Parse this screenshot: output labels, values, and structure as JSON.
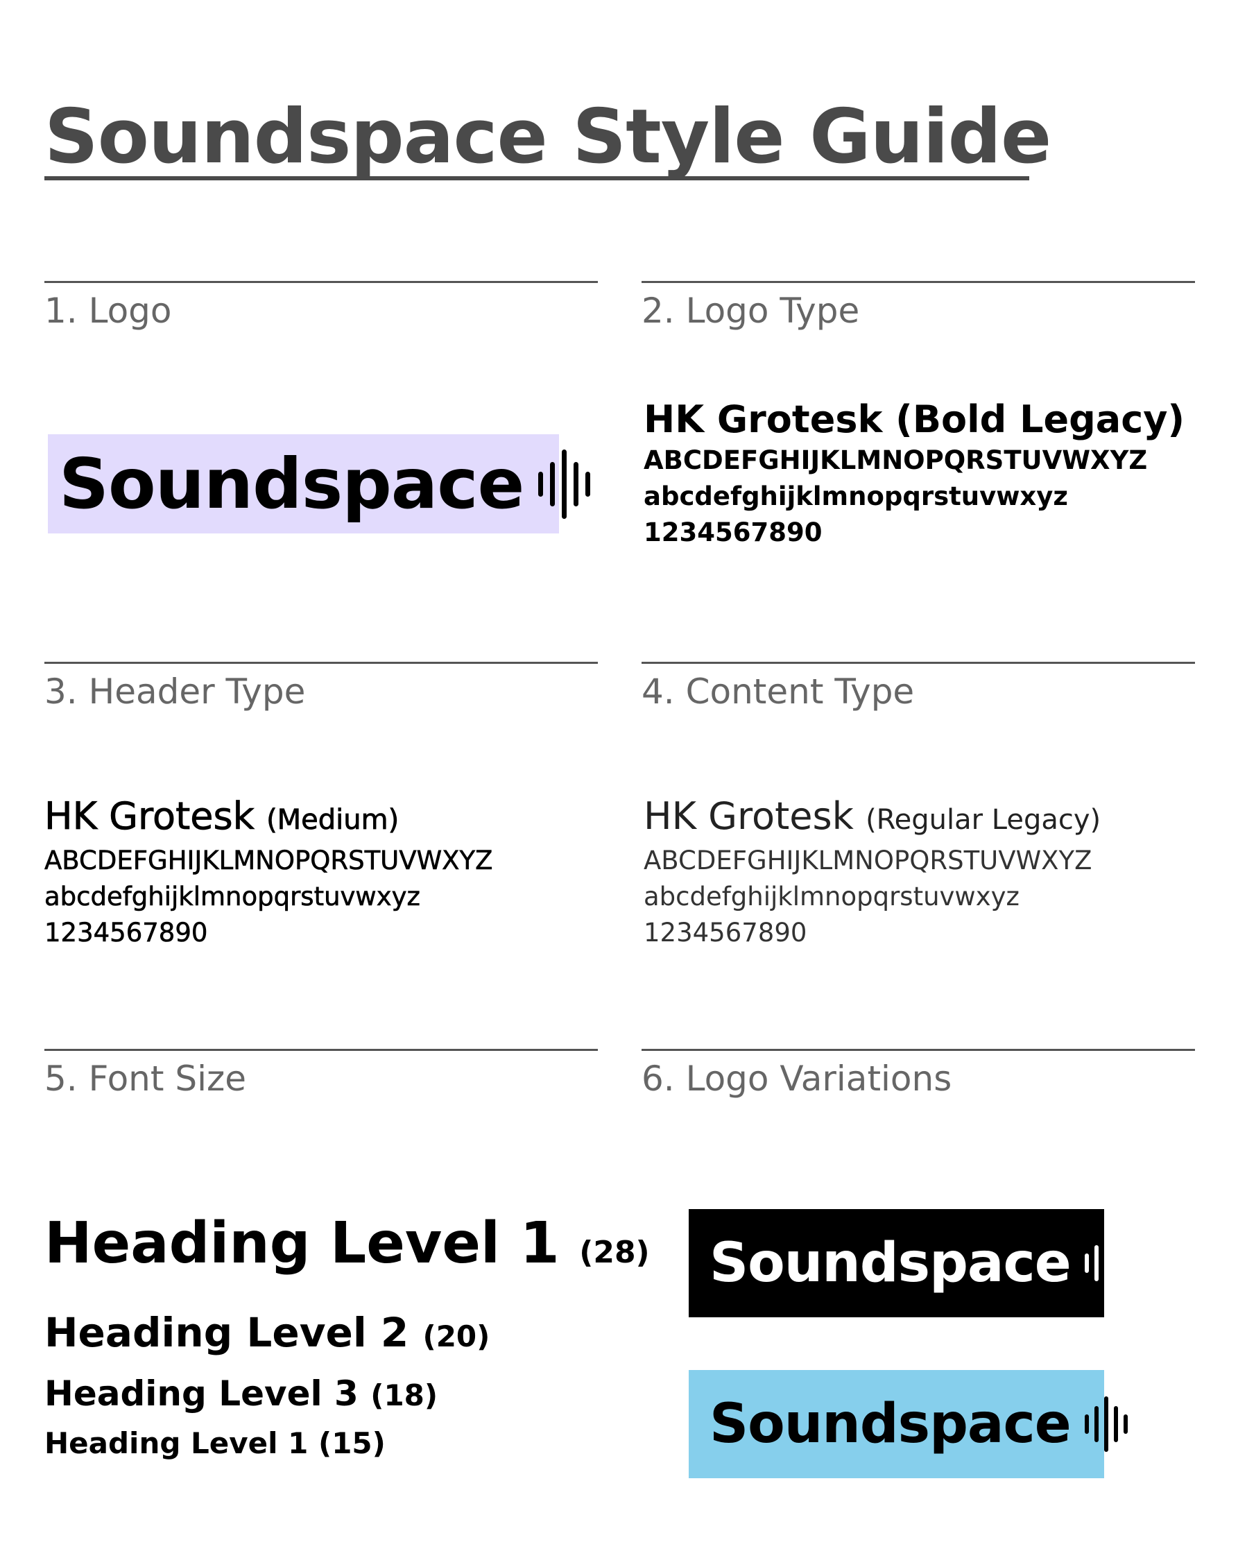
{
  "title": "Soundspace Style Guide",
  "sections": {
    "logo": {
      "label": "1. Logo"
    },
    "logo_type": {
      "label": "2. Logo Type"
    },
    "header_type": {
      "label": "3. Header Type"
    },
    "content_type": {
      "label": "4. Content Type"
    },
    "font_size": {
      "label": "5. Font Size"
    },
    "logo_variations": {
      "label": "6. Logo Variations"
    }
  },
  "logo": {
    "wordmark": "Soundspace",
    "icon": "sound-wave-icon",
    "background": "#e2dbfd",
    "variations": [
      {
        "wordmark": "Soundspace",
        "background": "#000000",
        "text_color": "#ffffff"
      },
      {
        "wordmark": "Soundspace",
        "background": "#86cfec",
        "text_color": "#000000"
      }
    ]
  },
  "logo_type": {
    "name": "HK Grotesk (Bold Legacy)",
    "uppercase": "ABCDEFGHIJKLMNOPQRSTUVWXYZ",
    "lowercase": "abcdefghijklmnopqrstuvwxyz",
    "digits": "1234567890"
  },
  "header_type": {
    "name": "HK Grotesk",
    "weight": "(Medium)",
    "uppercase": "ABCDEFGHIJKLMNOPQRSTUVWXYZ",
    "lowercase": "abcdefghijklmnopqrstuvwxyz",
    "digits": "1234567890"
  },
  "content_type": {
    "name": "HK Grotesk",
    "weight": "(Regular Legacy)",
    "uppercase": "ABCDEFGHIJKLMNOPQRSTUVWXYZ",
    "lowercase": "abcdefghijklmnopqrstuvwxyz",
    "digits": "1234567890"
  },
  "font_sizes": [
    {
      "label": "Heading Level 1",
      "size": "(28)"
    },
    {
      "label": "Heading Level 2",
      "size": "(20)"
    },
    {
      "label": "Heading Level 3",
      "size": "(18)"
    },
    {
      "label": "Heading Level 1",
      "size": "(15)"
    }
  ]
}
